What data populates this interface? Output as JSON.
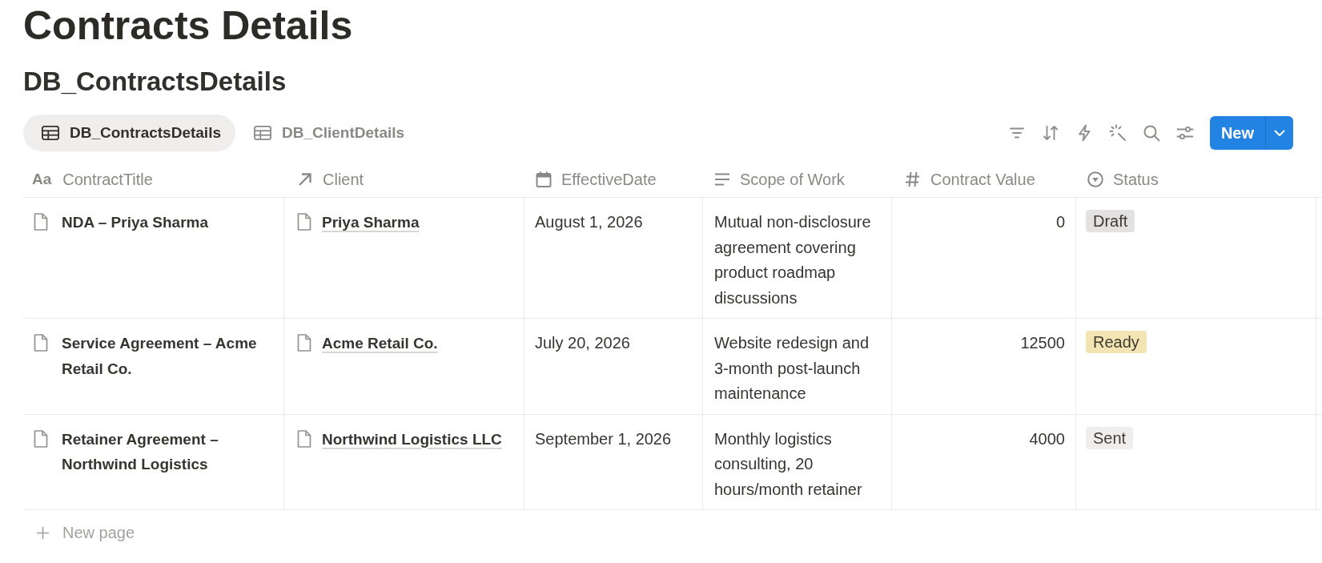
{
  "page": {
    "title": "Contracts Details"
  },
  "database": {
    "title": "DB_ContractsDetails"
  },
  "views": [
    {
      "label": "DB_ContractsDetails",
      "selected": true
    },
    {
      "label": "DB_ClientDetails",
      "selected": false
    }
  ],
  "new_button": {
    "label": "New"
  },
  "table": {
    "columns": [
      {
        "kind": "title",
        "glyph": "Aa",
        "label": "ContractTitle"
      },
      {
        "kind": "relation",
        "label": "Client"
      },
      {
        "kind": "date",
        "label": "EffectiveDate"
      },
      {
        "kind": "text",
        "label": "Scope of Work"
      },
      {
        "kind": "number",
        "label": "Contract Value"
      },
      {
        "kind": "status",
        "label": "Status"
      }
    ],
    "rows": [
      {
        "cells": [
          "NDA – Priya Sharma",
          "Priya Sharma",
          "August 1, 2026",
          "Mutual non-disclosure agreement covering product roadmap discussions",
          "0",
          {
            "label": "Draft",
            "color": "#e3e2e0"
          }
        ]
      },
      {
        "cells": [
          "Service Agreement – Acme Retail Co.",
          "Acme Retail Co.",
          "July 20, 2026",
          "Website redesign and 3-month post-launch maintenance",
          "12500",
          {
            "label": "Ready",
            "color": "#f3e4b4"
          }
        ]
      },
      {
        "cells": [
          "Retainer Agreement – Northwind Logistics",
          "Northwind Logistics LLC",
          "September 1, 2026",
          "Monthly logistics consulting, 20 hours/month retainer",
          "4000",
          {
            "label": "Sent",
            "color": "#efeeec"
          }
        ]
      }
    ],
    "new_row": {
      "label": "New page"
    }
  }
}
